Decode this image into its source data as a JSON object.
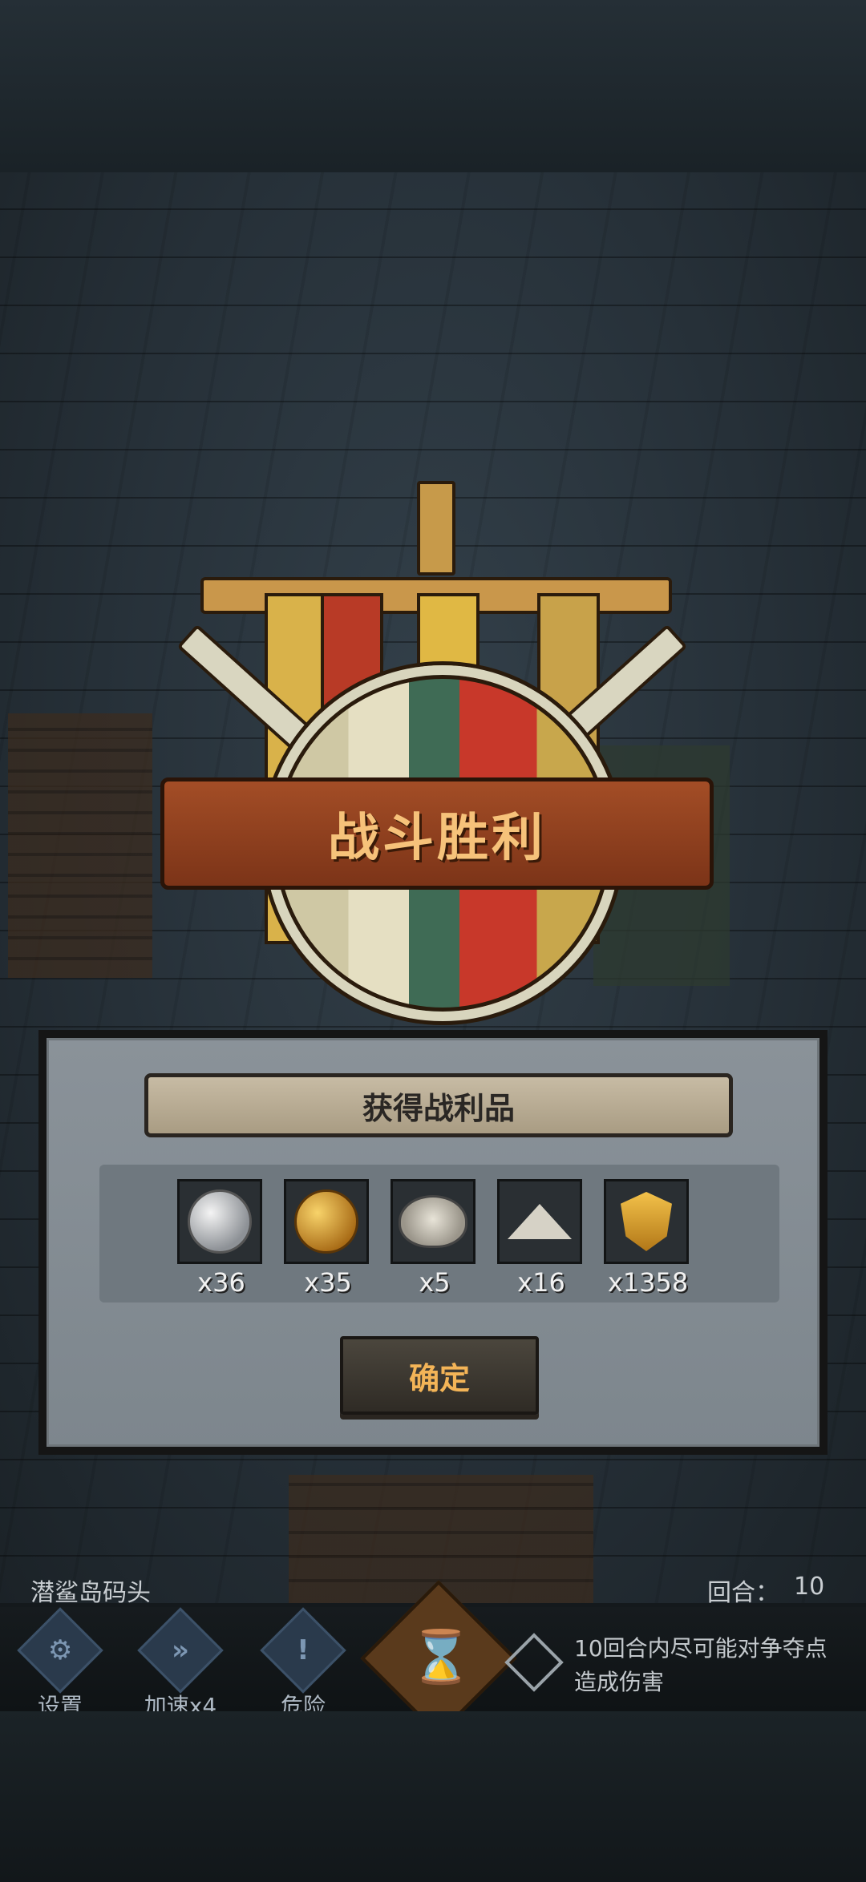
{
  "victory": {
    "banner_text": "战斗胜利"
  },
  "dialog": {
    "title": "获得战利品",
    "items": [
      {
        "icon": "silver-coin-icon",
        "count": "x36"
      },
      {
        "icon": "gold-coin-icon",
        "count": "x35"
      },
      {
        "icon": "oyster-icon",
        "count": "x5"
      },
      {
        "icon": "salt-pile-icon",
        "count": "x16"
      },
      {
        "icon": "gold-shield-medal-icon",
        "count": "x1358"
      }
    ],
    "confirm_label": "确定"
  },
  "hud": {
    "location": "潜鲨岛码头",
    "round_label": "回合：",
    "round_value": "10",
    "buttons": [
      {
        "icon": "gears-icon",
        "label": "设置"
      },
      {
        "icon": "fast-forward-icon",
        "label": "加速x4"
      },
      {
        "icon": "exclamation-icon",
        "label": "危险"
      }
    ],
    "objective": "10回合内尽可能对争夺点造成伤害"
  },
  "colors": {
    "banner_text": "#f6c27a",
    "confirm_text": "#f3b457",
    "dialog_bg": "#858d94"
  }
}
